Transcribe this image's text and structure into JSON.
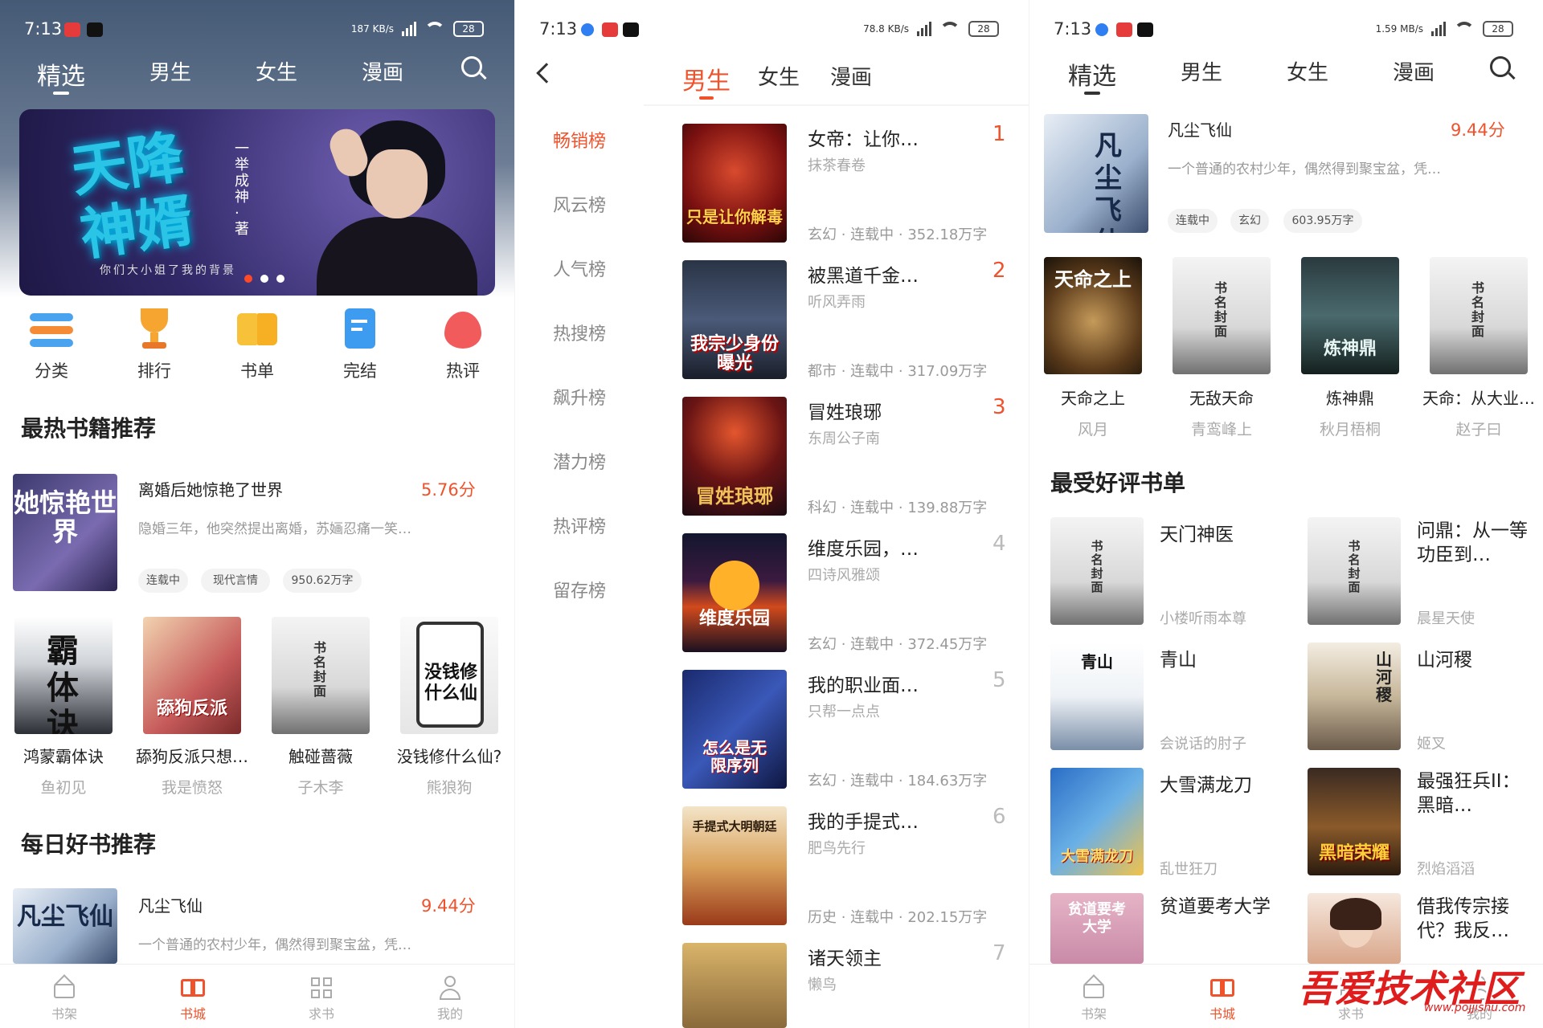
{
  "colors": {
    "accent": "#f0522c",
    "text": "#222222",
    "muted": "#999999"
  },
  "s1": {
    "status": {
      "time": "7:13",
      "speed": "187 KB/s",
      "hd": "HD",
      "battery": "28"
    },
    "tabs": [
      "精选",
      "男生",
      "女生",
      "漫画"
    ],
    "active_tab": "精选",
    "banner": {
      "title": "天降神婿",
      "author": "一举成神·著",
      "subtitle": "你们大小姐了我的背景",
      "dots": 3
    },
    "quick": [
      "分类",
      "排行",
      "书单",
      "完结",
      "热评"
    ],
    "hot_title": "最热书籍推荐",
    "hot": {
      "title": "离婚后她惊艳了世界",
      "score": "5.76分",
      "desc": "隐婚三年，他突然提出离婚，苏婳忍痛一笑…",
      "tags": [
        "连载中",
        "现代言情",
        "950.62万字"
      ],
      "cover_text": "她惊艳世界"
    },
    "grid": [
      {
        "title": "鸿蒙霸体诀",
        "author": "鱼初见",
        "cover_text": "霸体诀"
      },
      {
        "title": "舔狗反派只想…",
        "author": "我是愤怒",
        "cover_text": "舔狗反派"
      },
      {
        "title": "触碰蔷薇",
        "author": "子木李",
        "cover_text": "书名封面"
      },
      {
        "title": "没钱修什么仙?",
        "author": "熊狼狗",
        "cover_text": "没钱修什么仙"
      }
    ],
    "daily_title": "每日好书推荐",
    "daily": {
      "title": "凡尘飞仙",
      "score": "9.44分",
      "desc": "一个普通的农村少年，偶然得到聚宝盆，凭…",
      "cover_text": "凡尘飞仙"
    },
    "nav": [
      "书架",
      "书城",
      "求书",
      "我的"
    ],
    "nav_active": "书城"
  },
  "s2": {
    "status": {
      "time": "7:13",
      "speed": "78.8 KB/s",
      "hd": "HD",
      "battery": "28"
    },
    "tabs": [
      "男生",
      "女生",
      "漫画"
    ],
    "active_tab": "男生",
    "side": [
      "畅销榜",
      "风云榜",
      "人气榜",
      "热搜榜",
      "飙升榜",
      "潜力榜",
      "热评榜",
      "留存榜"
    ],
    "side_active": "畅销榜",
    "ranks": [
      {
        "title": "女帝：让你…",
        "author": "抹茶春卷",
        "num": "1",
        "meta": "玄幻 · 连载中 · 352.18万字",
        "cover_text": "只是让你解毒"
      },
      {
        "title": "被黑道千金…",
        "author": "听风弄雨",
        "num": "2",
        "meta": "都市 · 连载中 · 317.09万字",
        "cover_text": "我宗少身份曝光"
      },
      {
        "title": "冒姓琅琊",
        "author": "东周公子南",
        "num": "3",
        "meta": "科幻 · 连载中 · 139.88万字",
        "cover_text": "冒姓琅琊"
      },
      {
        "title": "维度乐园，…",
        "author": "四诗风雅颂",
        "num": "4",
        "meta": "玄幻 · 连载中 · 372.45万字",
        "cover_text": "维度乐园"
      },
      {
        "title": "我的职业面…",
        "author": "只帮一点点",
        "num": "5",
        "meta": "玄幻 · 连载中 · 184.63万字",
        "cover_text": "怎么是无限序列"
      },
      {
        "title": "我的手提式…",
        "author": "肥鸟先行",
        "num": "6",
        "meta": "历史 · 连载中 · 202.15万字",
        "cover_text": "手提式大明朝廷"
      },
      {
        "title": "诸天领主",
        "author": "懒鸟",
        "num": "7",
        "meta": "",
        "cover_text": ""
      }
    ]
  },
  "s3": {
    "status": {
      "time": "7:13",
      "speed": "1.59 MB/s",
      "hd": "HD",
      "battery": "28"
    },
    "tabs": [
      "精选",
      "男生",
      "女生",
      "漫画"
    ],
    "active_tab": "精选",
    "top": {
      "title": "凡尘飞仙",
      "score": "9.44分",
      "desc": "一个普通的农村少年，偶然得到聚宝盆，凭…",
      "tags": [
        "连载中",
        "玄幻",
        "603.95万字"
      ],
      "cover_text": "凡尘飞仙"
    },
    "grid": [
      {
        "title": "天命之上",
        "author": "风月",
        "cover_text": "天命之上"
      },
      {
        "title": "无敌天命",
        "author": "青鸾峰上",
        "cover_text": "书名封面"
      },
      {
        "title": "炼神鼎",
        "author": "秋月梧桐",
        "cover_text": "炼神鼎"
      },
      {
        "title": "天命：从大业…",
        "author": "赵子曰",
        "cover_text": "书名封面"
      }
    ],
    "list_title": "最受好评书单",
    "list": [
      {
        "title": "天门神医",
        "author": "小楼听雨本尊",
        "cover_text": "书名封面"
      },
      {
        "title": "问鼎：从一等功臣到…",
        "author": "晨星天使",
        "cover_text": "书名封面"
      },
      {
        "title": "青山",
        "author": "会说话的肘子",
        "cover_text": "青山"
      },
      {
        "title": "山河稷",
        "author": "姬叉",
        "cover_text": "山河稷"
      },
      {
        "title": "大雪满龙刀",
        "author": "乱世狂刀",
        "cover_text": "大雪满龙刀"
      },
      {
        "title": "最强狂兵II：黑暗…",
        "author": "烈焰滔滔",
        "cover_text": "黑暗荣耀"
      },
      {
        "title": "贫道要考大学",
        "author": "",
        "cover_text": "贫道要考大学"
      },
      {
        "title": "借我传宗接代？我反…",
        "author": "",
        "cover_text": ""
      }
    ],
    "nav": [
      "书架",
      "书城",
      "求书",
      "我的"
    ],
    "nav_active": "书城",
    "watermark": "吾爱技术社区",
    "watermark_url": "www.pojjishu.com"
  }
}
